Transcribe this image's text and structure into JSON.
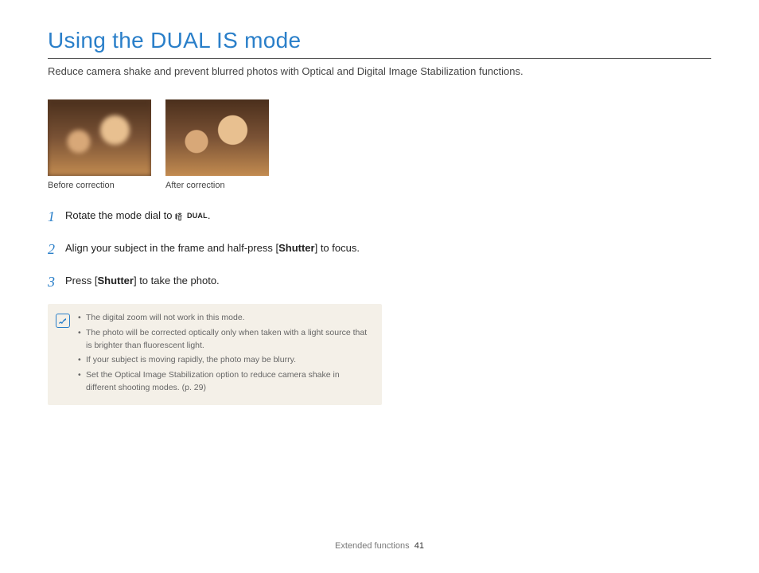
{
  "title": "Using the DUAL IS mode",
  "subtitle": "Reduce camera shake and prevent blurred photos with Optical and Digital Image Stabilization functions.",
  "photos": {
    "before_caption": "Before correction",
    "after_caption": "After correction"
  },
  "steps": [
    {
      "num": "1",
      "text_before": "Rotate the mode dial to ",
      "icon_label": "DUAL",
      "text_after": "."
    },
    {
      "num": "2",
      "text_before": "Align your subject in the frame and half-press [",
      "bold": "Shutter",
      "text_after": "] to focus."
    },
    {
      "num": "3",
      "text_before": "Press [",
      "bold": "Shutter",
      "text_after": "] to take the photo."
    }
  ],
  "notes": [
    "The digital zoom will not work in this mode.",
    "The photo will be corrected optically only when taken with a light source that is brighter than fluorescent light.",
    "If your subject is moving rapidly, the photo may be blurry.",
    "Set the Optical Image Stabilization option to reduce camera shake in different shooting modes. (p. 29)"
  ],
  "footer": {
    "section": "Extended functions",
    "page": "41"
  }
}
